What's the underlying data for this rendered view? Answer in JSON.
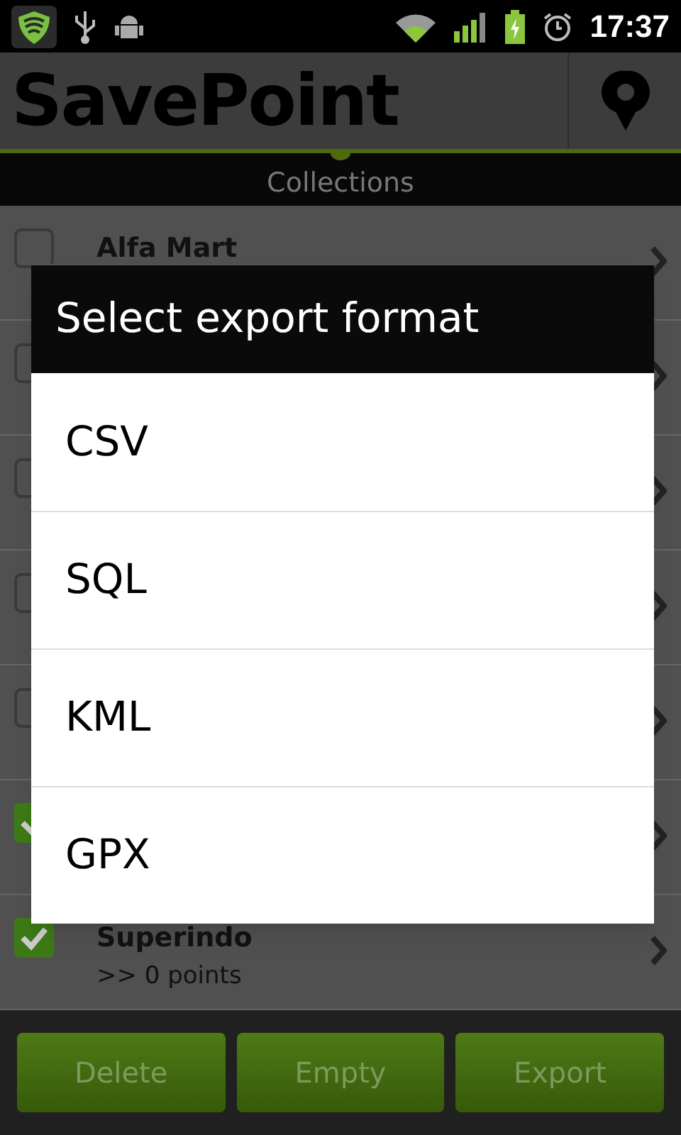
{
  "status_bar": {
    "time": "17:37"
  },
  "app_bar": {
    "title": "SavePoint"
  },
  "tab": {
    "label": "Collections"
  },
  "collections": [
    {
      "name": "Alfa Mart",
      "checked": false
    },
    {
      "checked": false
    },
    {
      "checked": false
    },
    {
      "checked": false
    },
    {
      "checked": false
    },
    {
      "checked": true
    },
    {
      "name": "Superindo",
      "detail": ">> 0 points",
      "checked": true
    }
  ],
  "buttons": [
    {
      "label": "Delete"
    },
    {
      "label": "Empty"
    },
    {
      "label": "Export"
    }
  ],
  "dialog": {
    "title": "Select export format",
    "options": [
      "CSV",
      "SQL",
      "KML",
      "GPX"
    ]
  }
}
